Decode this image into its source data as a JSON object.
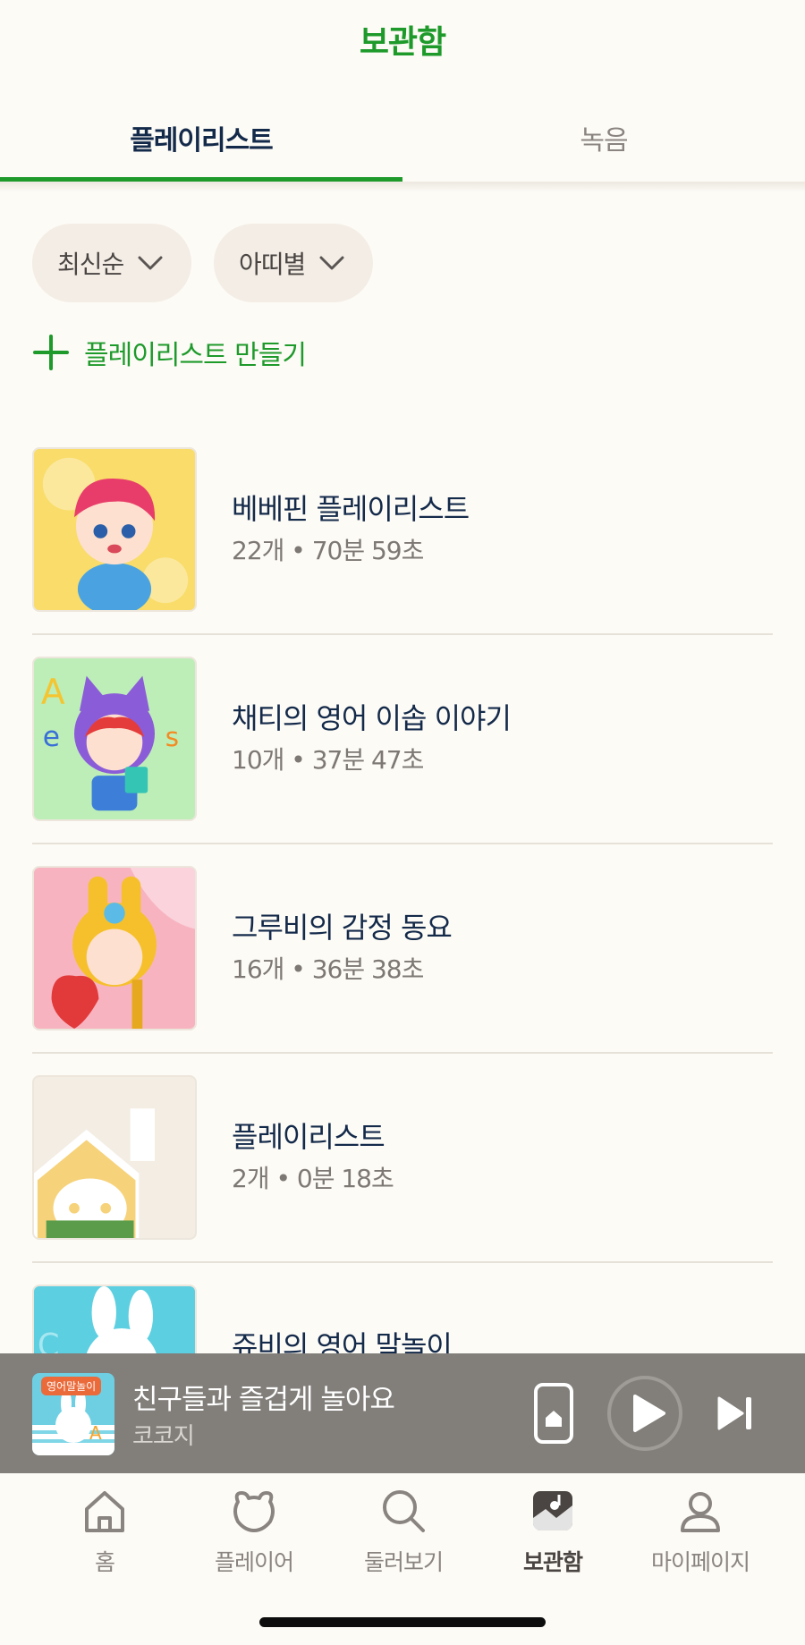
{
  "header": {
    "title": "보관함"
  },
  "tabs": [
    {
      "label": "플레이리스트",
      "active": true
    },
    {
      "label": "녹음",
      "active": false
    }
  ],
  "filters": [
    {
      "label": "최신순"
    },
    {
      "label": "아띠별"
    }
  ],
  "create_playlist_label": "플레이리스트 만들기",
  "playlists": [
    {
      "title": "베베핀 플레이리스트",
      "meta": "22개 • 70분 59초"
    },
    {
      "title": "채티의 영어 이솝 이야기",
      "meta": "10개 • 37분 47초"
    },
    {
      "title": "그루비의 감정 동요",
      "meta": "16개 • 36분 38초"
    },
    {
      "title": "플레이리스트",
      "meta": "2개 • 0분 18초"
    },
    {
      "title": "쥬비의 영어 말놀이",
      "meta": ""
    }
  ],
  "mini_player": {
    "art_badge": "영어말놀이",
    "title": "친구들과 즐겁게 놀아요",
    "artist": "코코지"
  },
  "bottom_nav": [
    {
      "label": "홈",
      "icon": "home-icon"
    },
    {
      "label": "플레이어",
      "icon": "bear-icon"
    },
    {
      "label": "둘러보기",
      "icon": "search-icon"
    },
    {
      "label": "보관함",
      "icon": "library-icon",
      "active": true
    },
    {
      "label": "마이페이지",
      "icon": "profile-icon"
    }
  ],
  "colors": {
    "accent": "#1e9a2b",
    "background": "#fdfbf6",
    "chip": "#f3ede5",
    "mini_player": "#827f7b"
  }
}
